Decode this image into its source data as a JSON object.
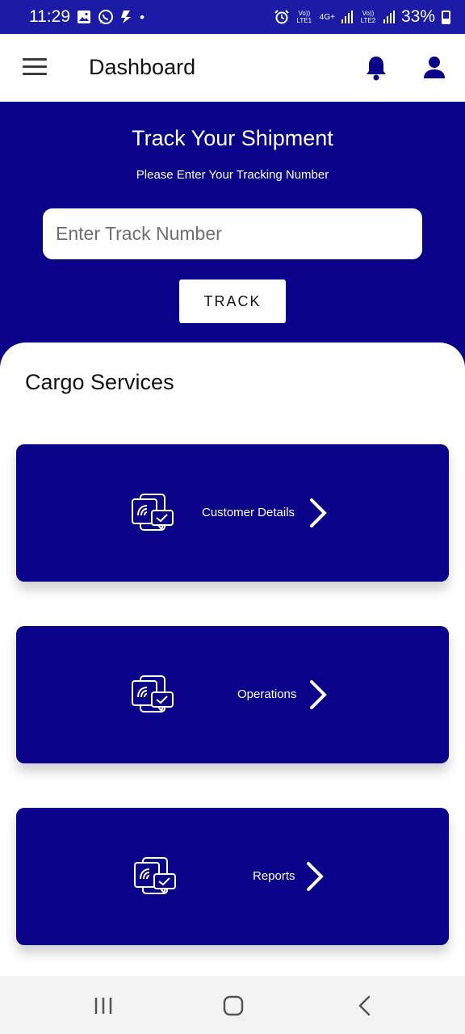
{
  "status_bar": {
    "time": "11:29",
    "dot": "•",
    "sim1_label": "Vo)) LTE1",
    "sim1_net": "4G+",
    "sim2_label": "Vo)) LTE2",
    "battery_pct": "33%",
    "icons": [
      "gallery-icon",
      "whatsapp-icon",
      "app-icon",
      "alarm-icon",
      "signal-icon",
      "battery-icon"
    ]
  },
  "app_bar": {
    "title": "Dashboard",
    "icons": [
      "menu-icon",
      "bell-icon",
      "user-icon"
    ]
  },
  "track": {
    "title": "Track Your Shipment",
    "subtitle": "Please Enter Your Tracking Number",
    "input_placeholder": "Enter Track Number",
    "input_value": "",
    "button_label": "TRACK"
  },
  "services": {
    "title": "Cargo Services",
    "cards": [
      {
        "label": "Customer Details",
        "icon": "devices-check-icon"
      },
      {
        "label": "Operations",
        "icon": "devices-check-icon"
      },
      {
        "label": "Reports",
        "icon": "devices-check-icon"
      }
    ]
  },
  "nav_bar": {
    "icons": [
      "recents-icon",
      "home-icon",
      "back-icon"
    ]
  },
  "colors": {
    "primary": "#0a0288",
    "status_bar": "#1b1ba6",
    "white": "#ffffff",
    "nav_bg": "#f3f3f3"
  }
}
